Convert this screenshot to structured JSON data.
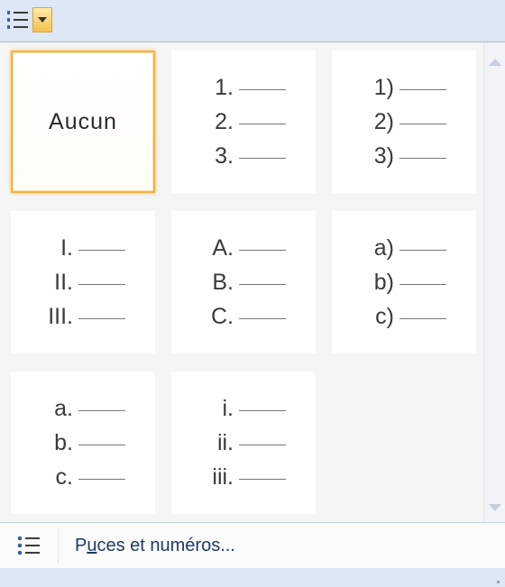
{
  "toolbar": {
    "button_icon": "numbered-list-icon",
    "dropdown_icon": "dropdown-arrow"
  },
  "gallery": {
    "none_label": "Aucun",
    "tiles": [
      {
        "markers": [
          "1.",
          "2.",
          "3."
        ]
      },
      {
        "markers": [
          "1)",
          "2)",
          "3)"
        ]
      },
      {
        "markers": [
          "I.",
          "II.",
          "III."
        ]
      },
      {
        "markers": [
          "A.",
          "B.",
          "C."
        ]
      },
      {
        "markers": [
          "a)",
          "b)",
          "c)"
        ]
      },
      {
        "markers": [
          "a.",
          "b.",
          "c."
        ]
      },
      {
        "markers": [
          "i.",
          "ii.",
          "iii."
        ]
      }
    ]
  },
  "footer": {
    "command_label": "Puces et numéros...",
    "command_accel": "u",
    "command_icon": "bullets-icon"
  },
  "colors": {
    "accent_border": "#f3b347",
    "header_bg": "#dde7f5"
  }
}
